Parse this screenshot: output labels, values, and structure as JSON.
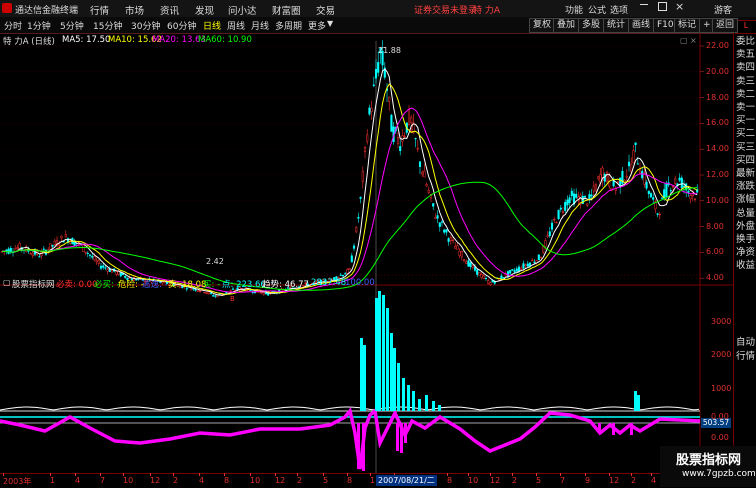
{
  "app": {
    "title": "通达信金融终端"
  },
  "menu": [
    "行情",
    "市场",
    "资讯",
    "发现",
    "问小达",
    "财富圈",
    "交易"
  ],
  "status": {
    "warning": "证券交易未登录",
    "stock": "特 力A"
  },
  "topright": [
    "功能",
    "公式",
    "选项",
    "游客"
  ],
  "toolbar": {
    "periods": [
      "分时",
      "1分钟",
      "5分钟",
      "15分钟",
      "30分钟",
      "60分钟",
      "日线",
      "周线",
      "月线",
      "多周期",
      "更多"
    ],
    "active": "日线",
    "right_buttons": [
      "复权",
      "叠加",
      "多股",
      "统计",
      "画线",
      "F10",
      "标记",
      "+自选",
      "返回"
    ]
  },
  "chart_header": {
    "name": "特 力A (日线)",
    "ma5": "MA5: 17.50",
    "ma10": "MA10: 15.62",
    "ma20": "MA20: 13.63",
    "ma60": "MA60: 10.90",
    "high_label": "21.88",
    "low_label": "2.42"
  },
  "indicator_header": {
    "name": "股票指标网",
    "bimai": "必卖: 0.00",
    "bimai2": "必买: -",
    "danger": "危险: -",
    "escape": "逃逸: -",
    "sell": "卖: 18.08",
    "buy": "买: -",
    "point": "点: 223.66",
    "trend": "趋势: 46.77",
    "v1": "2837.48",
    "v2": "100.00"
  },
  "price_axis": [
    "22.00",
    "20.00",
    "18.00",
    "16.00",
    "14.00",
    "12.00",
    "10.00",
    "8.00",
    "6.00",
    "4.00"
  ],
  "ind_axis": [
    "3000",
    "2000",
    "1000",
    "0.00",
    "0.00"
  ],
  "ind_marker": "503.57",
  "side_panel": [
    "委比",
    "卖五",
    "卖四",
    "卖三",
    "卖二",
    "卖一",
    "买一",
    "买二",
    "买三",
    "买四",
    "最新",
    "涨跌",
    "涨幅",
    "总量",
    "外盘",
    "换手",
    "净资",
    "收益"
  ],
  "side_panel_bottom": [
    "自动",
    "行情"
  ],
  "x_axis": [
    "2003年",
    "1",
    "4",
    "7",
    "10",
    "12",
    "2",
    "4",
    "8",
    "10",
    "12",
    "2",
    "5",
    "8",
    "11",
    "1",
    "4",
    "8",
    "10",
    "12",
    "2",
    "5",
    "7",
    "9",
    "12",
    "2",
    "4"
  ],
  "cursor_date": "2007/08/21/二",
  "watermark": {
    "line1": "股票指标网",
    "line2": "www.7gpzb.com"
  },
  "colors": {
    "up": "#ff3030",
    "down": "#00ffff",
    "ma5": "#ffffff",
    "ma10": "#ffff00",
    "ma20": "#ff00ff",
    "ma60": "#00ff00",
    "accent": "#ffff00"
  }
}
